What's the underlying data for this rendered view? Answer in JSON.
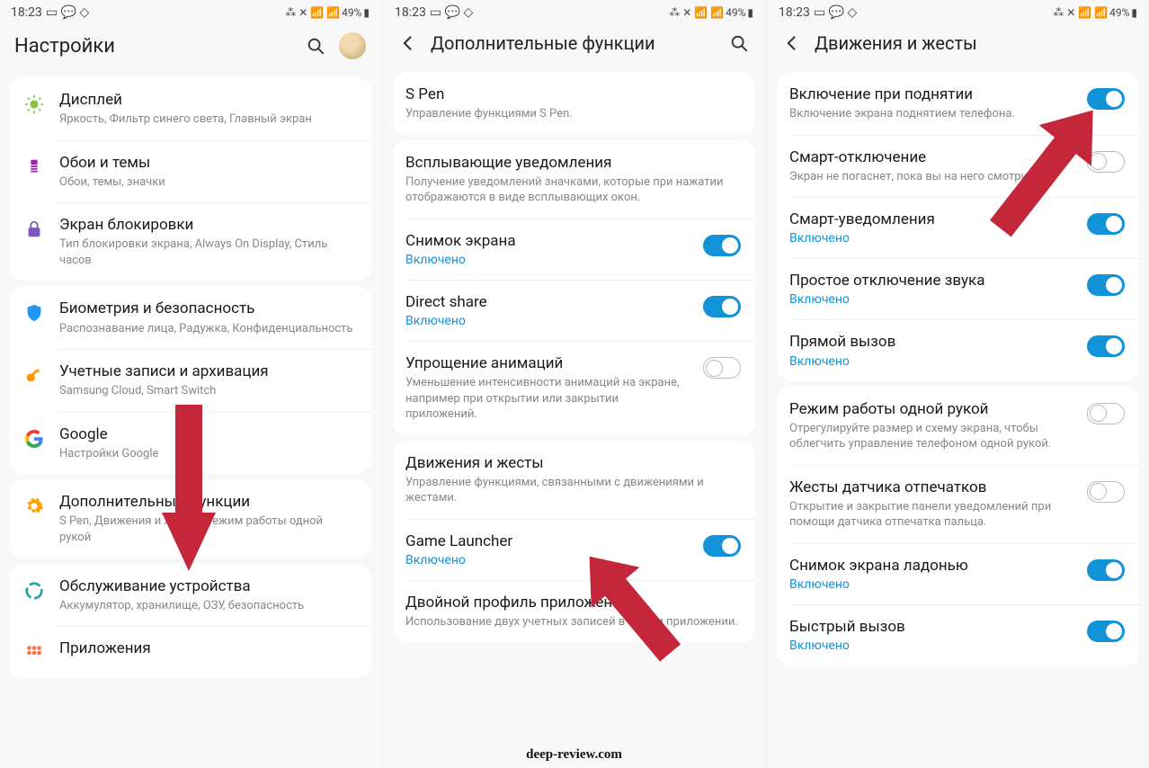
{
  "status": {
    "time": "18:23",
    "battery": "49%"
  },
  "screen1": {
    "title": "Настройки",
    "groups": [
      {
        "items": [
          {
            "icon": "display",
            "title": "Дисплей",
            "sub": "Яркость, Фильтр синего света, Главный экран"
          },
          {
            "icon": "wallpaper",
            "title": "Обои и темы",
            "sub": "Обои, темы, значки"
          },
          {
            "icon": "lock",
            "title": "Экран блокировки",
            "sub": "Тип блокировки экрана, Always On Display, Стиль часов"
          }
        ]
      },
      {
        "items": [
          {
            "icon": "shield",
            "title": "Биометрия и безопасность",
            "sub": "Распознавание лица, Радужка, Конфиденциальность"
          },
          {
            "icon": "key",
            "title": "Учетные записи и архивация",
            "sub": "Samsung Cloud, Smart Switch"
          },
          {
            "icon": "google",
            "title": "Google",
            "sub": "Настройки Google"
          }
        ]
      },
      {
        "items": [
          {
            "icon": "gear",
            "title": "Дополнительные функции",
            "sub": "S Pen, Движения и жесты, Режим работы одной рукой"
          }
        ]
      },
      {
        "items": [
          {
            "icon": "care",
            "title": "Обслуживание устройства",
            "sub": "Аккумулятор, хранилище, ОЗУ, безопасность"
          },
          {
            "icon": "apps",
            "title": "Приложения",
            "sub": ""
          }
        ]
      }
    ]
  },
  "screen2": {
    "title": "Дополнительные функции",
    "groups": [
      {
        "items": [
          {
            "title": "S Pen",
            "sub": "Управление функциями S Pen."
          }
        ]
      },
      {
        "items": [
          {
            "title": "Всплывающие уведомления",
            "sub": "Получение уведомлений значками, которые при нажатии отображаются в виде всплывающих окон."
          },
          {
            "title": "Снимок экрана",
            "status": "Включено",
            "toggle": "on"
          },
          {
            "title": "Direct share",
            "status": "Включено",
            "toggle": "on"
          },
          {
            "title": "Упрощение анимаций",
            "sub": "Уменьшение интенсивности анимаций на экране, например при открытии или закрытии приложений.",
            "toggle": "off"
          }
        ]
      },
      {
        "items": [
          {
            "title": "Движения и жесты",
            "sub": "Управление функциями, связанными с движениями и жестами."
          },
          {
            "title": "Game Launcher",
            "status": "Включено",
            "toggle": "on"
          },
          {
            "title": "Двойной профиль приложений",
            "sub": "Использование двух учетных записей в одном приложении."
          }
        ]
      }
    ]
  },
  "screen3": {
    "title": "Движения и жесты",
    "groups": [
      {
        "items": [
          {
            "title": "Включение при поднятии",
            "sub": "Включение экрана поднятием телефона.",
            "toggle": "on"
          },
          {
            "title": "Смарт-отключение",
            "sub": "Экран не погаснет, пока вы на него смотрите.",
            "toggle": "off"
          },
          {
            "title": "Смарт-уведомления",
            "status": "Включено",
            "toggle": "on"
          },
          {
            "title": "Простое отключение звука",
            "status": "Включено",
            "toggle": "on"
          },
          {
            "title": "Прямой вызов",
            "status": "Включено",
            "toggle": "on"
          }
        ]
      },
      {
        "items": [
          {
            "title": "Режим работы одной рукой",
            "sub": "Отрегулируйте размер и схему экрана, чтобы облегчить управление телефоном одной рукой.",
            "toggle": "off"
          },
          {
            "title": "Жесты датчика отпечатков",
            "sub": "Открытие и закрытие панели уведомлений при помощи датчика отпечатка пальца.",
            "toggle": "off"
          },
          {
            "title": "Снимок экрана ладонью",
            "status": "Включено",
            "toggle": "on"
          },
          {
            "title": "Быстрый вызов",
            "status": "Включено",
            "toggle": "on"
          }
        ]
      }
    ]
  },
  "watermark": "deep-review.com",
  "iconColors": {
    "display": "#8bc34a",
    "wallpaper": "#9c27b0",
    "lock": "#7e57c2",
    "shield": "#2196f3",
    "key": "#ff9800",
    "google": "#4285f4",
    "gear": "#ffa000",
    "care": "#26a69a",
    "apps": "#ff7043"
  }
}
